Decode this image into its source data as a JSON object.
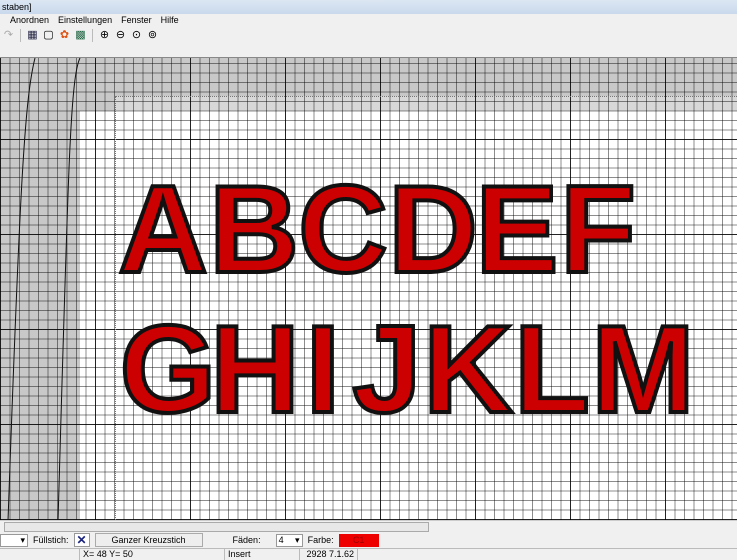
{
  "window": {
    "title": "staben]"
  },
  "menu": [
    "Anordnen",
    "Einstellungen",
    "Fenster",
    "Hilfe"
  ],
  "toolbar": {
    "icons": [
      "redo-icon",
      "grid-icon",
      "frame-icon",
      "color-icon",
      "pattern-icon",
      "zoom-in-icon",
      "zoom-out-icon",
      "zoom-fit-icon",
      "zoom-reset-icon"
    ]
  },
  "canvas": {
    "row1": [
      "A",
      "B",
      "C",
      "D",
      "E",
      "F"
    ],
    "row2": [
      "G",
      "H",
      "I",
      "J",
      "K",
      "L",
      "M"
    ],
    "stitch_color": "#cc0000"
  },
  "bottombar": {
    "fill_label": "Füllstich:",
    "stitch_button": "Ganzer Kreuzstich",
    "threads_label": "Fäden:",
    "threads_value": "4",
    "color_label": "Farbe:",
    "color_value": "C1",
    "color_hex": "#ee0000"
  },
  "status": {
    "coords": "X= 48  Y= 50",
    "mode": "Insert",
    "info": "2928  7.1.62"
  }
}
